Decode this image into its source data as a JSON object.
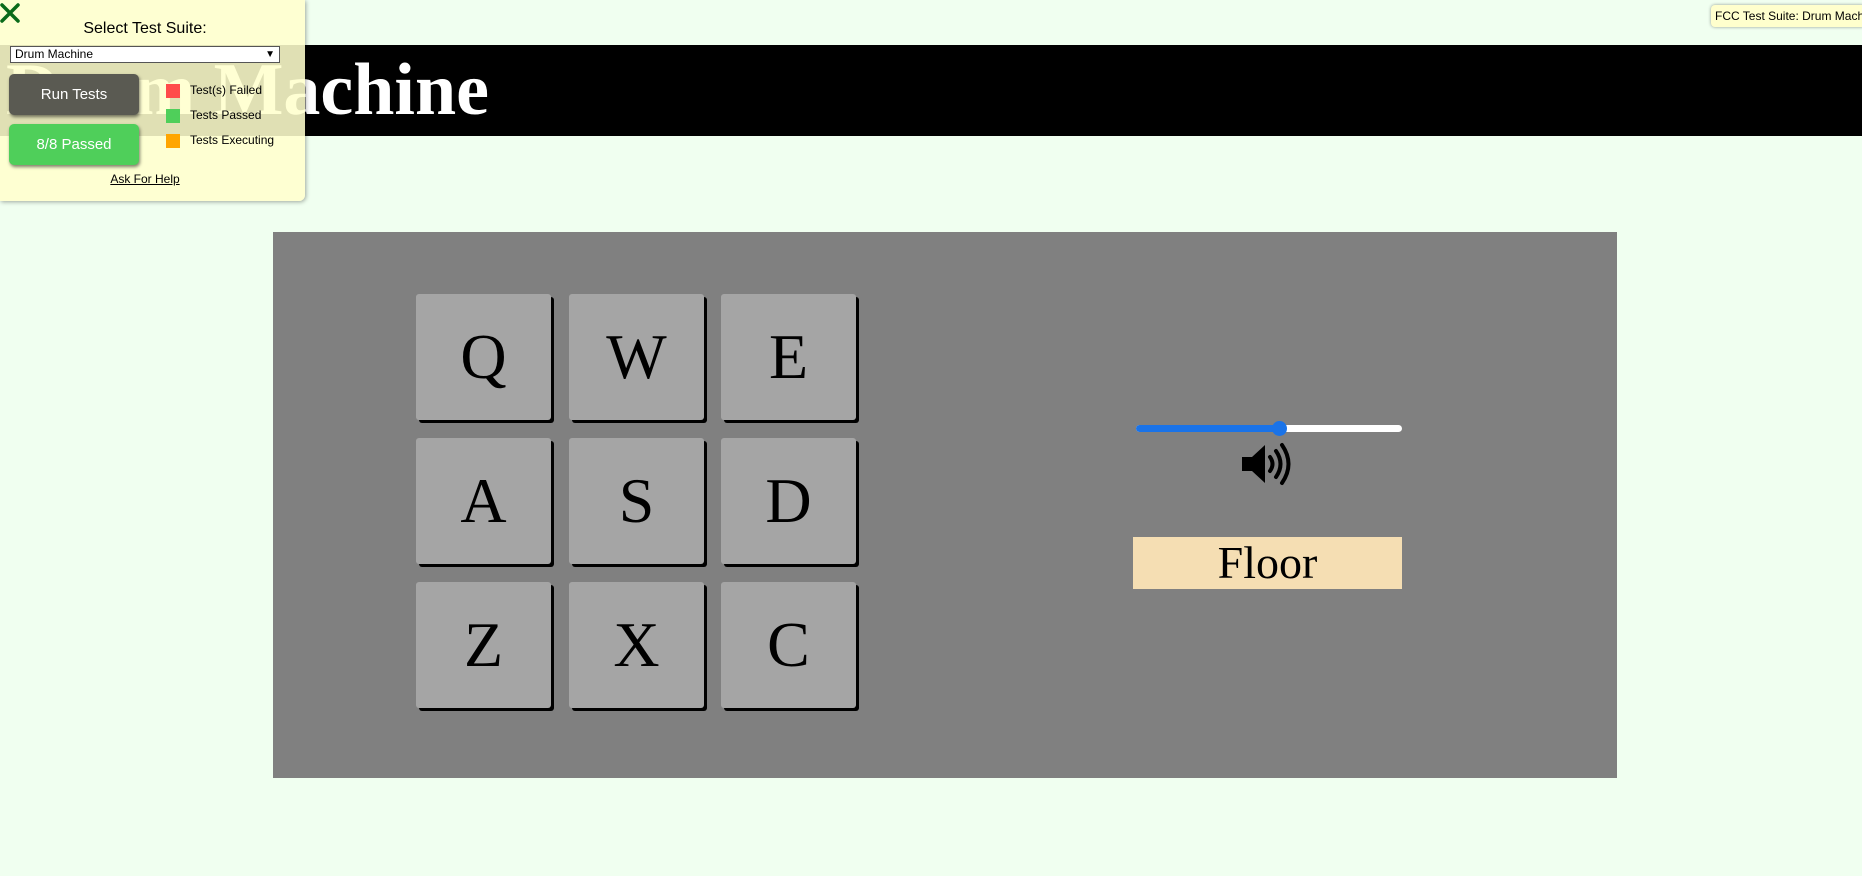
{
  "header": {
    "title": "Drum Machine"
  },
  "pads": [
    {
      "key": "Q"
    },
    {
      "key": "W"
    },
    {
      "key": "E"
    },
    {
      "key": "A"
    },
    {
      "key": "S"
    },
    {
      "key": "D"
    },
    {
      "key": "Z"
    },
    {
      "key": "X"
    },
    {
      "key": "C"
    }
  ],
  "controls": {
    "volume": 0.54,
    "volume_icon": "volume-up-icon",
    "display": "Floor",
    "accent": "#1a73e8"
  },
  "test_panel": {
    "close_icon": "close-icon",
    "select_label": "Select Test Suite:",
    "selected_suite": "Drum Machine",
    "run_label": "Run Tests",
    "result_label": "8/8 Passed",
    "legend": [
      {
        "label": "Test(s) Failed",
        "color": "#ff4b4b"
      },
      {
        "label": "Tests Passed",
        "color": "#4fcf5a"
      },
      {
        "label": "Tests Executing",
        "color": "#ffa500"
      }
    ],
    "help_label": "Ask For Help"
  },
  "badge": {
    "label": "FCC Test Suite: Drum Machine"
  }
}
